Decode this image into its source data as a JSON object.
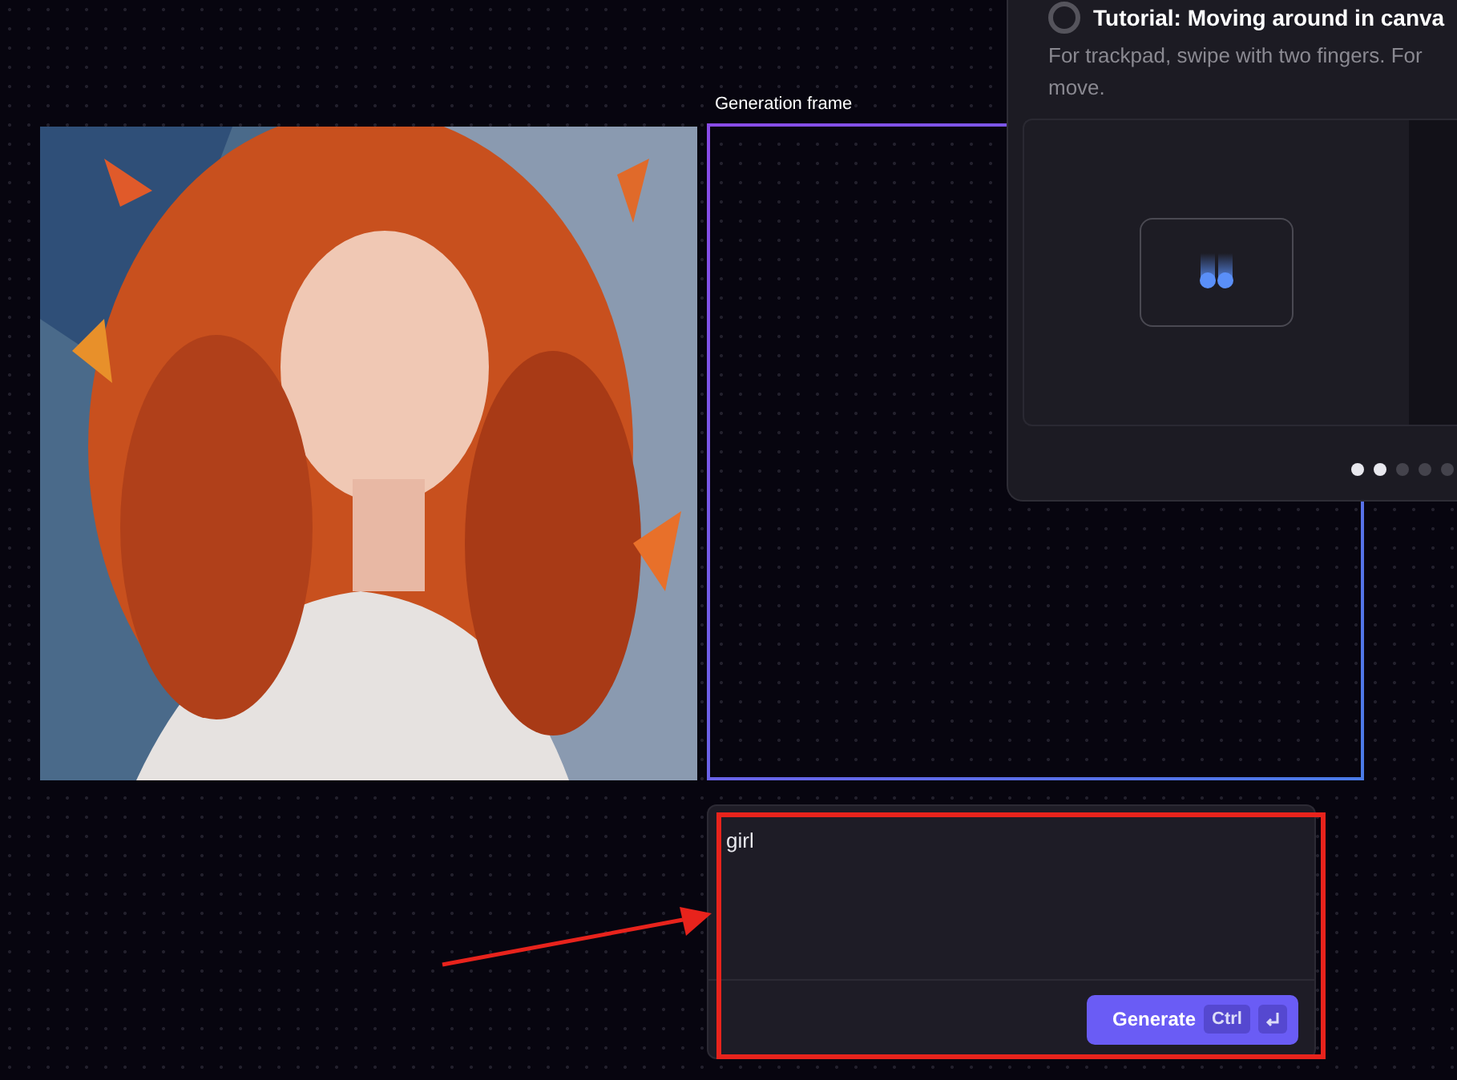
{
  "canvas": {
    "frame_label": "Generation frame"
  },
  "prompt": {
    "value": "girl",
    "button": {
      "label": "Generate",
      "shortcut": "Ctrl"
    }
  },
  "tutorial": {
    "title": "Tutorial: Moving around in canva",
    "description_lines": [
      "For trackpad, swipe with two fingers. For",
      "move."
    ],
    "pages": [
      {
        "filled": true
      },
      {
        "filled": true
      },
      {
        "filled": false
      },
      {
        "filled": false
      },
      {
        "filled": false
      }
    ]
  },
  "annotation": {
    "highlight": true,
    "arrow": true
  }
}
